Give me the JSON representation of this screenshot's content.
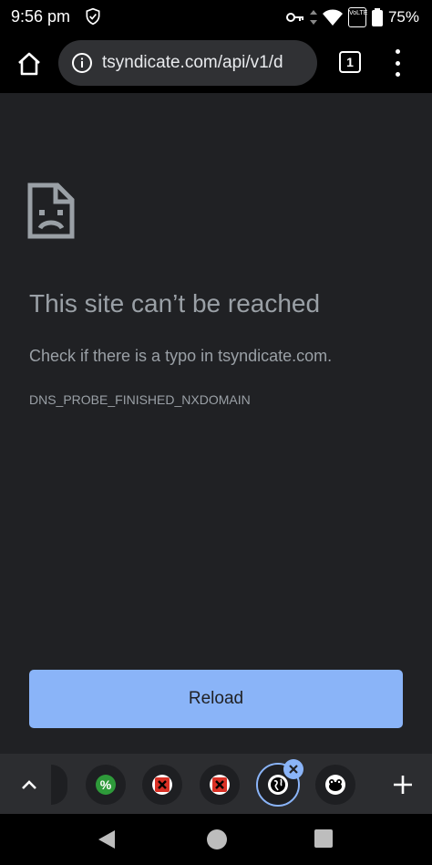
{
  "status_bar": {
    "time": "9:56 pm",
    "battery_percent": "75%",
    "volte_label": "VoLTE",
    "icons": [
      "vpn-shield-icon",
      "vpn-key-icon",
      "data-arrows-icon",
      "wifi-icon",
      "volte-icon",
      "battery-icon"
    ]
  },
  "toolbar": {
    "url": "tsyndicate.com/api/v1/d",
    "tab_count": "1",
    "icons": [
      "home-icon",
      "info-icon",
      "tab-switcher-icon",
      "overflow-menu-icon"
    ]
  },
  "error_page": {
    "title": "This site can’t be reached",
    "description": "Check if there is a typo in tsyndicate.com.",
    "error_code": "DNS_PROBE_FINISHED_NXDOMAIN",
    "reload_label": "Reload",
    "icon": "sad-page-icon"
  },
  "tab_strip": {
    "icons": [
      "chevron-up-icon",
      "percent-favicon",
      "red-x-favicon",
      "red-x-favicon",
      "globe-favicon",
      "frog-favicon",
      "close-icon",
      "plus-icon"
    ],
    "accent_color": "#8ab4f8"
  },
  "nav_bar": {
    "icons": [
      "back-icon",
      "home-circle-icon",
      "recents-icon"
    ]
  },
  "colors": {
    "background": "#202124",
    "text_secondary": "#9aa0a6",
    "button": "#8ab4f8"
  }
}
